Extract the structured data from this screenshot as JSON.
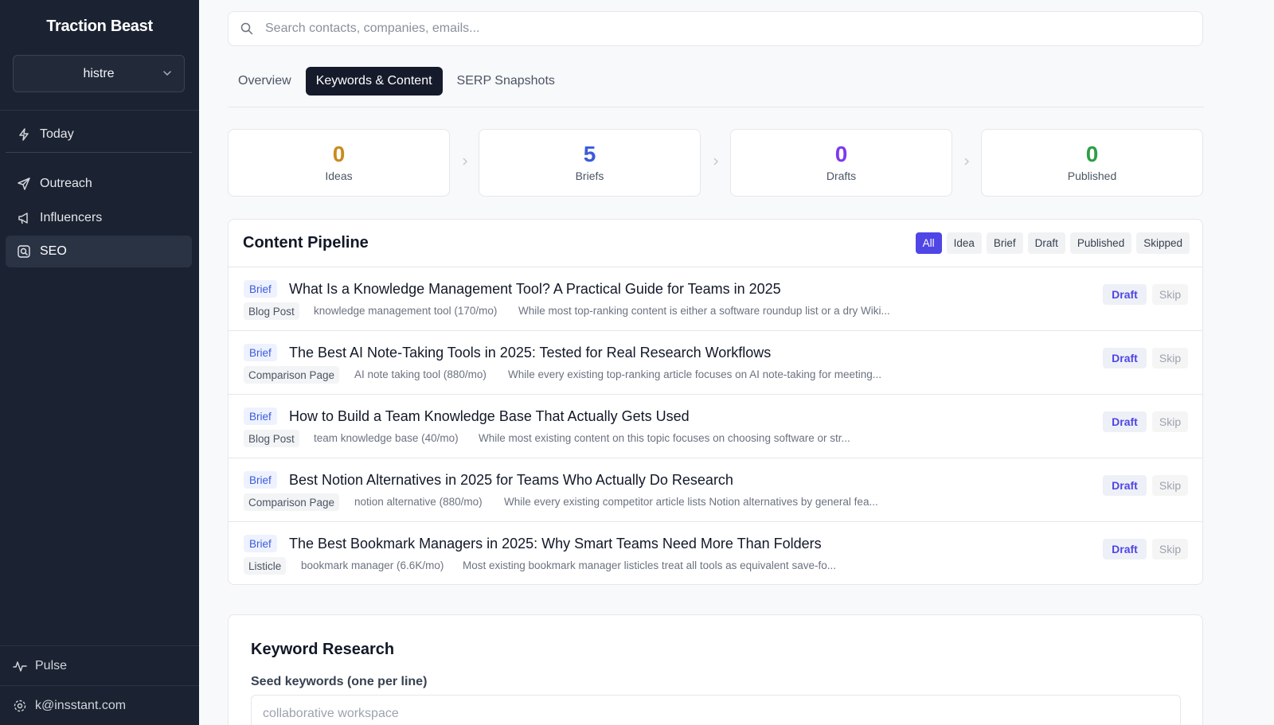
{
  "sidebar": {
    "brand": "Traction Beast",
    "workspace": "histre",
    "nav_today": "Today",
    "nav": [
      {
        "label": "Outreach",
        "icon": "send-icon"
      },
      {
        "label": "Influencers",
        "icon": "megaphone-icon"
      },
      {
        "label": "SEO",
        "icon": "search-icon",
        "active": true
      }
    ],
    "footer_pulse": "Pulse",
    "footer_user": "k@insstant.com"
  },
  "search": {
    "placeholder": "Search contacts, companies, emails..."
  },
  "tabs": [
    {
      "label": "Overview",
      "active": false
    },
    {
      "label": "Keywords & Content",
      "active": true
    },
    {
      "label": "SERP Snapshots",
      "active": false
    }
  ],
  "stats": [
    {
      "value": "0",
      "label": "Ideas",
      "color": "#c88b1e"
    },
    {
      "value": "5",
      "label": "Briefs",
      "color": "#3b5bdb"
    },
    {
      "value": "0",
      "label": "Drafts",
      "color": "#7c3aed"
    },
    {
      "value": "0",
      "label": "Published",
      "color": "#2f9e44"
    }
  ],
  "pipeline": {
    "title": "Content Pipeline",
    "filters": [
      "All",
      "Idea",
      "Brief",
      "Draft",
      "Published",
      "Skipped"
    ],
    "active_filter": "All",
    "draft_label": "Draft",
    "skip_label": "Skip",
    "items": [
      {
        "status": "Brief",
        "title": "What Is a Knowledge Management Tool? A Practical Guide for Teams in 2025",
        "type": "Blog Post",
        "keyword": "knowledge management tool (170/mo)",
        "summary": "While most top-ranking content is either a software roundup list or a dry Wiki..."
      },
      {
        "status": "Brief",
        "title": "The Best AI Note-Taking Tools in 2025: Tested for Real Research Workflows",
        "type": "Comparison Page",
        "keyword": "AI note taking tool (880/mo)",
        "summary": "While every existing top-ranking article focuses on AI note-taking for meeting..."
      },
      {
        "status": "Brief",
        "title": "How to Build a Team Knowledge Base That Actually Gets Used",
        "type": "Blog Post",
        "keyword": "team knowledge base (40/mo)",
        "summary": "While most existing content on this topic focuses on choosing software or str..."
      },
      {
        "status": "Brief",
        "title": "Best Notion Alternatives in 2025 for Teams Who Actually Do Research",
        "type": "Comparison Page",
        "keyword": "notion alternative (880/mo)",
        "summary": "While every existing competitor article lists Notion alternatives by general fea..."
      },
      {
        "status": "Brief",
        "title": "The Best Bookmark Managers in 2025: Why Smart Teams Need More Than Folders",
        "type": "Listicle",
        "keyword": "bookmark manager (6.6K/mo)",
        "summary": "Most existing bookmark manager listicles treat all tools as equivalent save-fo..."
      }
    ]
  },
  "keyword_research": {
    "title": "Keyword Research",
    "seed_label": "Seed keywords (one per line)",
    "seed_placeholder": "collaborative workspace\nwiki note building"
  }
}
